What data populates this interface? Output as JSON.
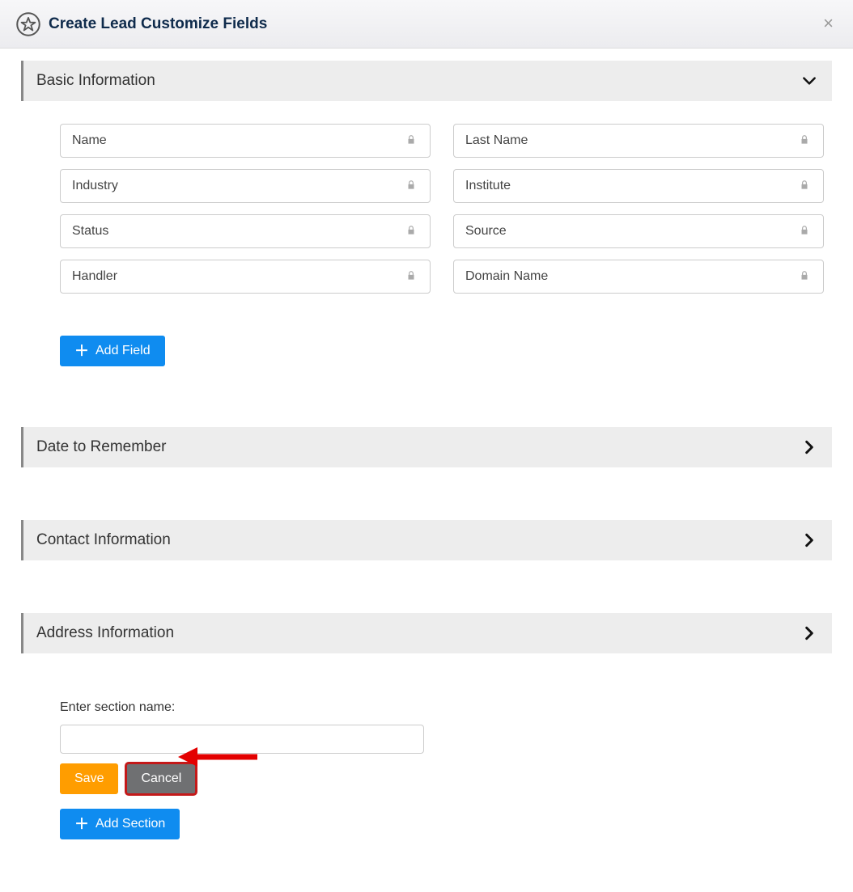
{
  "header": {
    "title": "Create Lead Customize Fields"
  },
  "sections": {
    "basic": {
      "title": "Basic Information",
      "expanded": true,
      "fields": [
        [
          "Name",
          "Last Name"
        ],
        [
          "Industry",
          "Institute"
        ],
        [
          "Status",
          "Source"
        ],
        [
          "Handler",
          "Domain Name"
        ]
      ],
      "add_field_label": "Add Field"
    },
    "date": {
      "title": "Date to Remember",
      "expanded": false
    },
    "contact": {
      "title": "Contact Information",
      "expanded": false
    },
    "address": {
      "title": "Address Information",
      "expanded": false
    }
  },
  "new_section": {
    "label": "Enter section name:",
    "value": "",
    "save_label": "Save",
    "cancel_label": "Cancel",
    "add_section_label": "Add Section"
  },
  "annotation": {
    "target": "cancel-button",
    "color": "#c41919"
  },
  "colors": {
    "primary": "#0f8cf0",
    "warning": "#ff9d00",
    "gray": "#6f7072"
  }
}
